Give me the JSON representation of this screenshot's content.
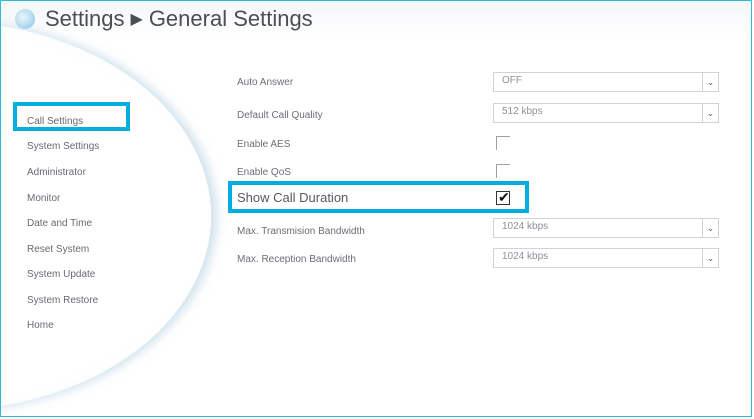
{
  "header": {
    "title": "Settings",
    "separator": "▶",
    "subtitle": "General Settings",
    "logo_icon": "settings-sphere-icon"
  },
  "sidebar": {
    "items": [
      {
        "label": "Call Settings",
        "selected": true
      },
      {
        "label": "System Settings"
      },
      {
        "label": "Administrator"
      },
      {
        "label": "Monitor"
      },
      {
        "label": "Date and Time"
      },
      {
        "label": "Reset System"
      },
      {
        "label": "System Update"
      },
      {
        "label": "System Restore"
      },
      {
        "label": "Home"
      }
    ]
  },
  "settings": {
    "auto_answer": {
      "label": "Auto Answer",
      "value": "OFF"
    },
    "default_call_quality": {
      "label": "Default Call Quality",
      "value": "512 kbps"
    },
    "enable_aes": {
      "label": "Enable AES",
      "checked": false
    },
    "enable_qos": {
      "label": "Enable QoS",
      "checked": false
    },
    "show_call_duration": {
      "label": "Show Call Duration",
      "checked": true,
      "check_glyph": "✔"
    },
    "max_transmission_bandwidth": {
      "label": "Max. Transmision Bandwidth",
      "value": "1024 kbps"
    },
    "max_reception_bandwidth": {
      "label": "Max. Reception Bandwidth",
      "value": "1024 kbps"
    }
  },
  "dropdown_glyph": "⌄",
  "colors": {
    "highlight": "#00aee0",
    "frame_border": "#2fb8d8"
  }
}
